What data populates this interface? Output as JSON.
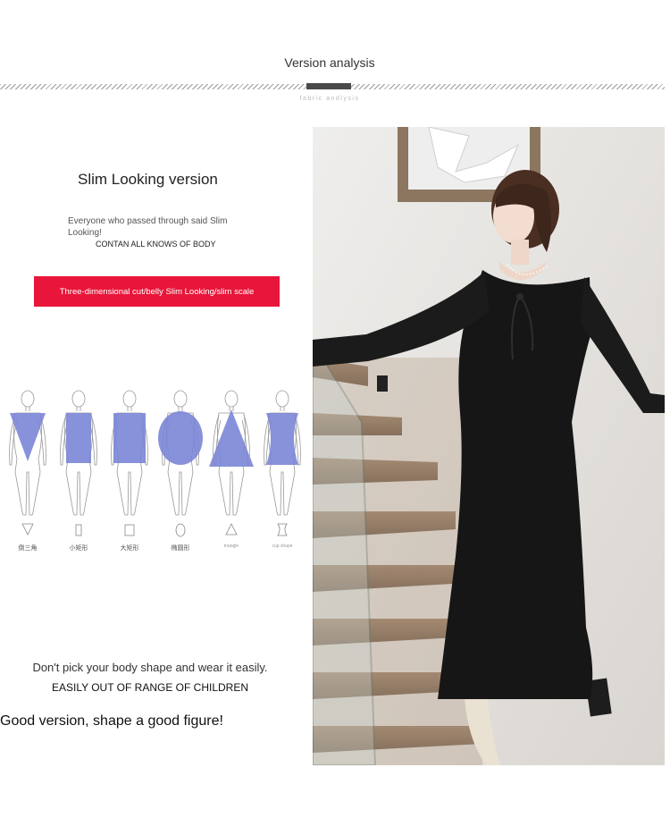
{
  "header": {
    "title": "Version analysis",
    "subtitle": "fabric andlysis"
  },
  "left": {
    "heading": "Slim Looking version",
    "desc_line1": "Everyone who passed through said Slim Looking!",
    "desc_line2": "CONTAN ALL KNOWS OF BODY",
    "red_banner": "Three-dimensional cut/belly Slim Looking/slim scale",
    "body_shapes": [
      {
        "symbol": "inverted-triangle-icon",
        "label": "倒三角"
      },
      {
        "symbol": "narrow-rectangle-icon",
        "label": "小矩形"
      },
      {
        "symbol": "rectangle-icon",
        "label": "大矩形"
      },
      {
        "symbol": "ellipse-icon",
        "label": "椭圆形"
      },
      {
        "symbol": "triangle-icon",
        "label": "triangle"
      },
      {
        "symbol": "hourglass-icon",
        "label": "cup shape"
      }
    ],
    "bottom_line1": "Don't pick your body shape and wear it easily.",
    "bottom_line2": "EASILY OUT OF RANGE OF CHILDREN",
    "bottom_line3": "Good version, shape a good figure!"
  },
  "colors": {
    "accent_red": "#e8163a",
    "shape_blue": "#7b86d6",
    "dress_black": "#161616"
  }
}
